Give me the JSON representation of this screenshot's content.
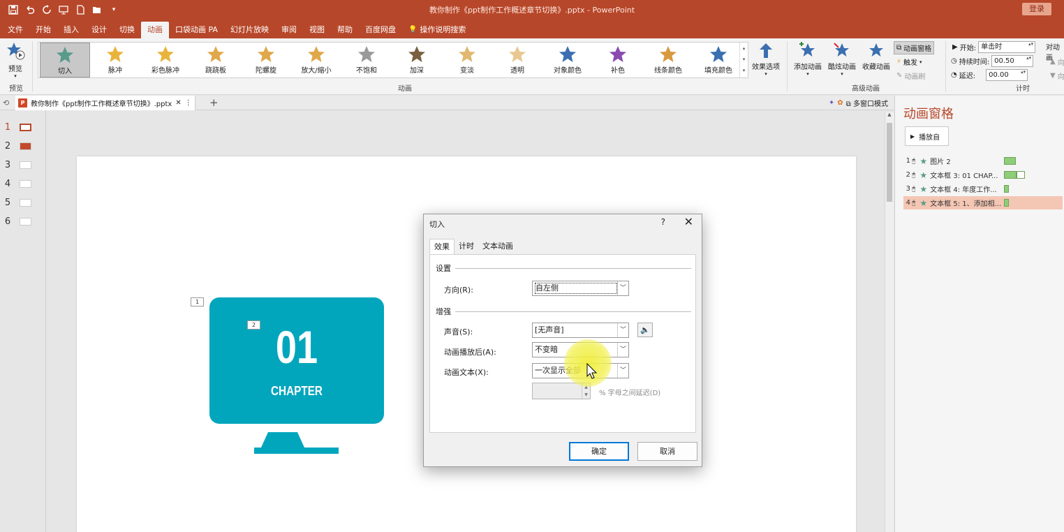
{
  "window": {
    "title": "教你制作《ppt制作工作概述章节切换》.pptx  -  PowerPoint",
    "login_label": "登录"
  },
  "quick_access": [
    "save-icon",
    "undo-icon",
    "redo-icon",
    "present-from-start-icon",
    "new-file-icon",
    "open-file-icon",
    "customize-icon"
  ],
  "tabs": [
    {
      "label": "文件"
    },
    {
      "label": "开始"
    },
    {
      "label": "插入"
    },
    {
      "label": "设计"
    },
    {
      "label": "切换"
    },
    {
      "label": "动画",
      "active": true
    },
    {
      "label": "口袋动画 PA"
    },
    {
      "label": "幻灯片放映"
    },
    {
      "label": "审阅"
    },
    {
      "label": "视图"
    },
    {
      "label": "帮助"
    },
    {
      "label": "百度网盘"
    },
    {
      "label": "操作说明搜索"
    }
  ],
  "ribbon": {
    "preview": {
      "button_label": "预览",
      "group_label": "预览"
    },
    "animation_group_label": "动画",
    "effects": [
      {
        "label": "切入",
        "color": "#5a9a8a",
        "selected": true
      },
      {
        "label": "脉冲",
        "color": "#e8b43c"
      },
      {
        "label": "彩色脉冲",
        "color": "#e8b43c"
      },
      {
        "label": "跷跷板",
        "color": "#e0a84a"
      },
      {
        "label": "陀螺旋",
        "color": "#e0a84a"
      },
      {
        "label": "放大/缩小",
        "color": "#e0a84a"
      },
      {
        "label": "不饱和",
        "color": "#9a9a9a"
      },
      {
        "label": "加深",
        "color": "#7a6040"
      },
      {
        "label": "变淡",
        "color": "#e0b870"
      },
      {
        "label": "透明",
        "color": "#e8c890"
      },
      {
        "label": "对象颜色",
        "color": "#3a6fb0"
      },
      {
        "label": "补色",
        "color": "#8a4ab0"
      },
      {
        "label": "线条颜色",
        "color": "#d89a40"
      },
      {
        "label": "填充颜色",
        "color": "#3a6fb0"
      }
    ],
    "effect_options_label": "效果选项",
    "advanced": {
      "group_label": "高级动画",
      "add_animation": "添加动画",
      "cool_animation": "酷炫动画",
      "favorite_animation": "收藏动画",
      "animation_pane": "动画窗格",
      "trigger": "触发",
      "animation_painter": "动画刷"
    },
    "timing": {
      "group_label": "计时",
      "start_label": "开始:",
      "start_value": "单击时",
      "duration_label": "持续时间:",
      "duration_value": "00.50",
      "delay_label": "延迟:",
      "delay_value": "00.00",
      "reorder_label": "对动画",
      "move_earlier": "向",
      "move_later": "向"
    }
  },
  "doc_tab": {
    "label": "教你制作《ppt制作工作概述章节切换》.pptx",
    "multi_window": "多窗口模式"
  },
  "thumbnails": [
    {
      "num": "1",
      "active": true,
      "color": "#fff"
    },
    {
      "num": "2",
      "color": "#c24a2a"
    },
    {
      "num": "3",
      "color": "#fff"
    },
    {
      "num": "4",
      "color": "#fff"
    },
    {
      "num": "5",
      "color": "#fff"
    },
    {
      "num": "6",
      "color": "#fff"
    }
  ],
  "slide": {
    "number": "01",
    "chapter": "CHAPTER",
    "tag1": "1",
    "tag2": "2",
    "accent": "#01a6bd"
  },
  "pane": {
    "title": "动画窗格",
    "play_from": "播放自",
    "items": [
      {
        "idx": "1",
        "text": "图片 2",
        "bar": "short"
      },
      {
        "idx": "2",
        "text": "文本框 3: 01 CHAP...",
        "bar": "long"
      },
      {
        "idx": "3",
        "text": "文本框 4: 年度工作...",
        "bar": "tiny"
      },
      {
        "idx": "4",
        "text": "文本框 5: 1、添加相...",
        "bar": "tiny",
        "selected": true
      }
    ]
  },
  "dialog": {
    "title": "切入",
    "help": "?",
    "close": "✕",
    "tabs": [
      "效果",
      "计时",
      "文本动画"
    ],
    "settings_header": "设置",
    "direction_label": "方向(R):",
    "direction_value": "自左侧",
    "enhance_header": "增强",
    "sound_label": "声音(S):",
    "sound_value": "[无声音]",
    "after_label": "动画播放后(A):",
    "after_value": "不变暗",
    "text_label": "动画文本(X):",
    "text_value": "一次显示全部",
    "delay_label": "% 字母之间延迟(D)",
    "ok": "确定",
    "cancel": "取消"
  }
}
